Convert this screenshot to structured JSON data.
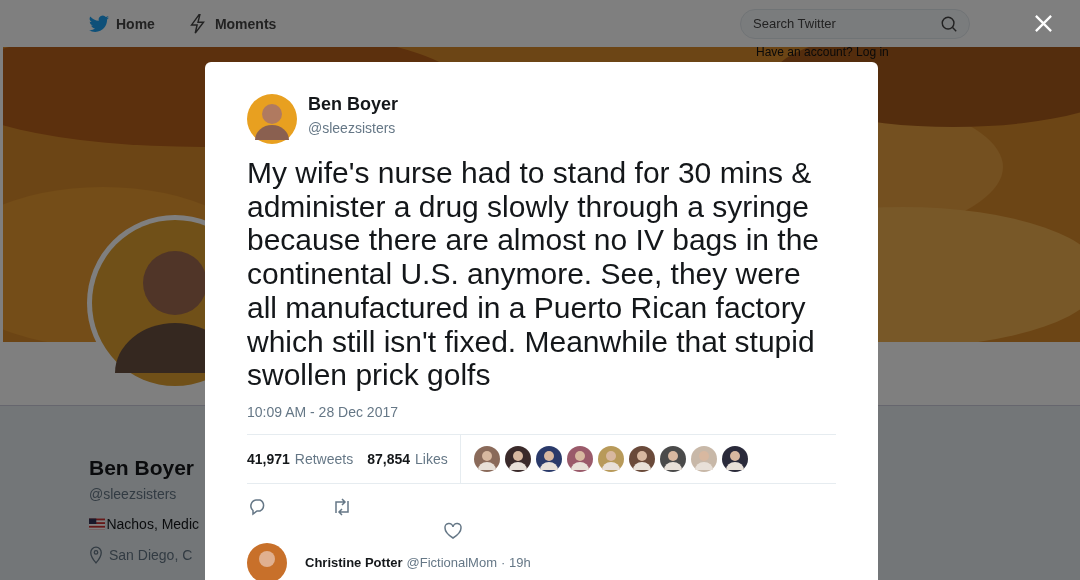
{
  "nav": {
    "items": [
      {
        "kind": "bird",
        "label": "Home"
      },
      {
        "kind": "bolt",
        "label": "Moments"
      }
    ],
    "search": {
      "placeholder": "Search Twitter"
    },
    "login_prompt": "Have an account? Log in"
  },
  "profile": {
    "name": "Ben Boyer",
    "handle": "@sleezsisters",
    "bio": "Nachos, Medic",
    "location": "San Diego, C"
  },
  "tweet": {
    "author": "Ben Boyer",
    "handle": "@sleezsisters",
    "text": "My wife's nurse had to stand for 30 mins & administer a drug slowly through a syringe because there are almost no IV bags in the continental U.S. anymore. See, they were all manufactured in a Puerto Rican factory which still isn't fixed. Meanwhile that stupid swollen prick golfs",
    "timestamp": "10:09 AM - 28 Dec 2017",
    "stats": [
      {
        "count": "41,971",
        "label": "Retweets"
      },
      {
        "count": "87,854",
        "label": "Likes"
      }
    ],
    "actions": [
      {
        "kind": "reply"
      },
      {
        "kind": "retweet"
      },
      {
        "kind": "like"
      }
    ]
  },
  "reply": {
    "author": "Christine Potter",
    "handle": "@FictionalMom",
    "separator": "·",
    "time": "19h"
  }
}
